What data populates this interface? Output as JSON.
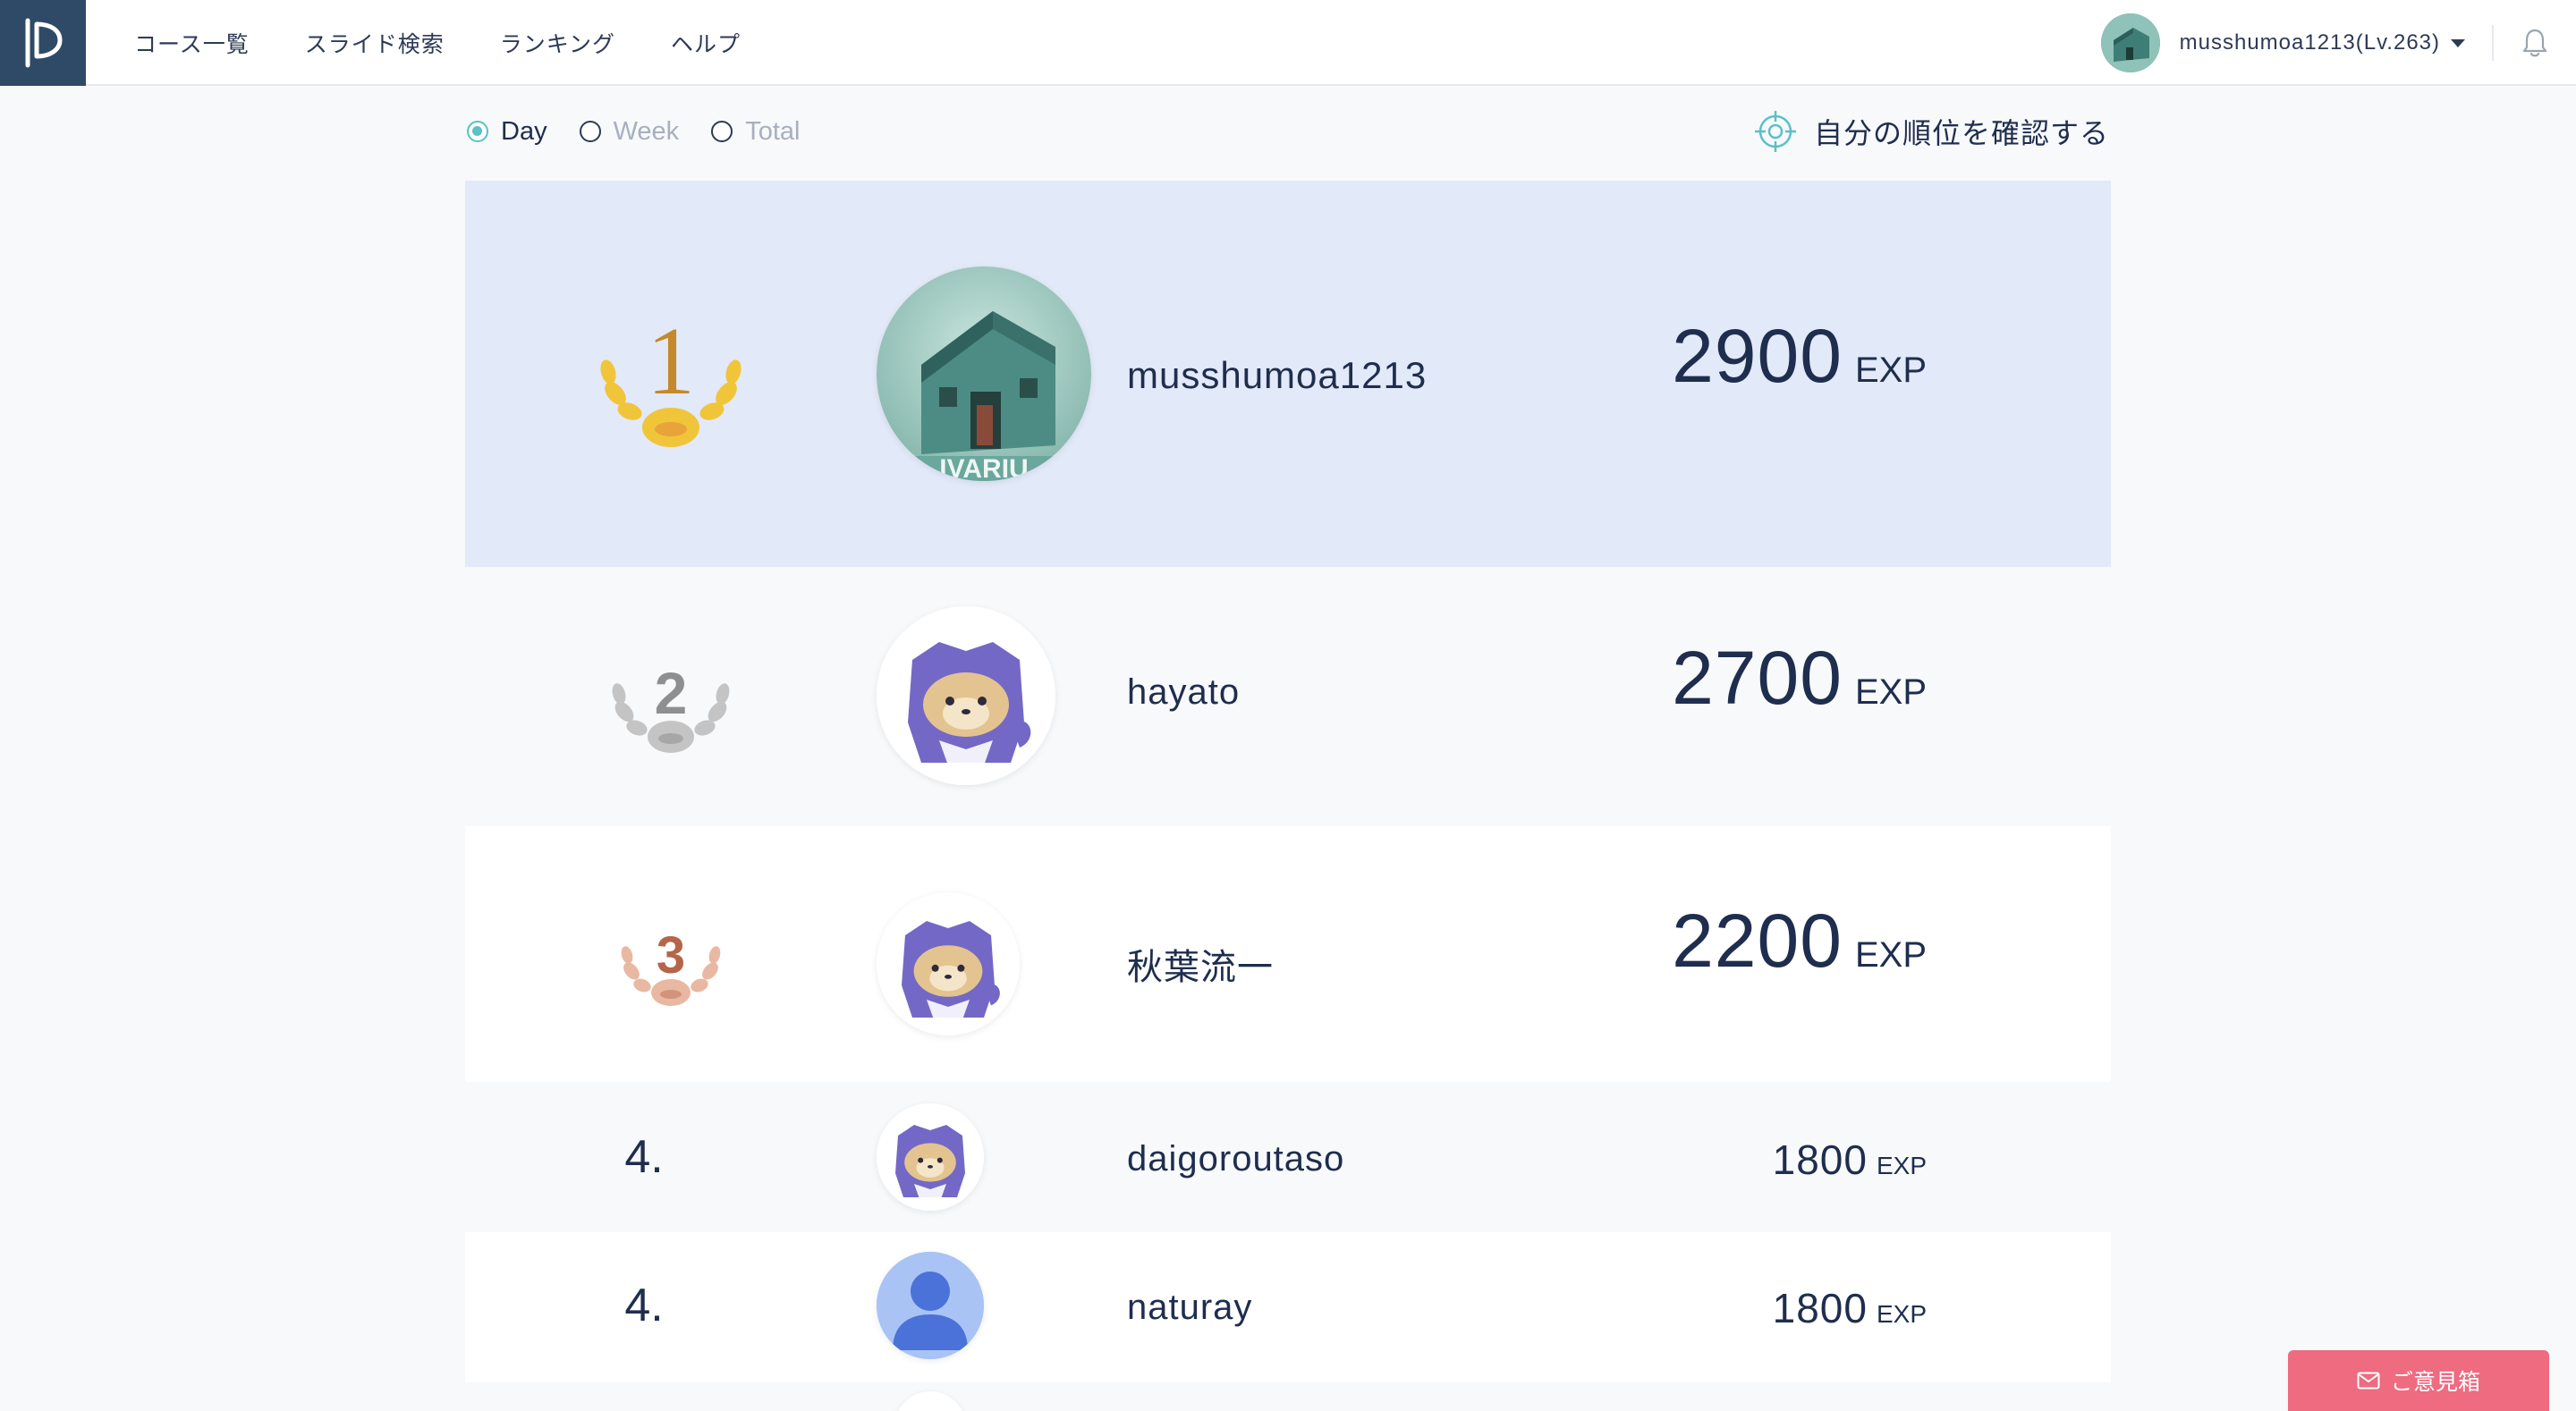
{
  "nav": {
    "items": [
      "コース一覧",
      "スライド検索",
      "ランキング",
      "ヘルプ"
    ]
  },
  "user": {
    "display": "musshumoa1213(Lv.263)"
  },
  "filters": {
    "options": [
      "Day",
      "Week",
      "Total"
    ],
    "selected": "Day",
    "my_rank_label": "自分の順位を確認する"
  },
  "ranking": [
    {
      "rank": "1",
      "name": "musshumoa1213",
      "score": "2900",
      "unit": "EXP",
      "avatar": "house-photo"
    },
    {
      "rank": "2",
      "name": "hayato",
      "score": "2700",
      "unit": "EXP",
      "avatar": "mascot"
    },
    {
      "rank": "3",
      "name": "秋葉流一",
      "score": "2200",
      "unit": "EXP",
      "avatar": "mascot"
    },
    {
      "rank": "4.",
      "name": "daigoroutaso",
      "score": "1800",
      "unit": "EXP",
      "avatar": "mascot"
    },
    {
      "rank": "4.",
      "name": "naturay",
      "score": "1800",
      "unit": "EXP",
      "avatar": "default-user"
    }
  ],
  "feedback": {
    "label": "ご意見箱"
  },
  "colors": {
    "accent": "#5bc0c8",
    "header_logo_bg": "#2f4a66",
    "highlight_row": "#e2e9f8",
    "gold": "#c4892b",
    "silver": "#8f8f8f",
    "bronze": "#b5654a",
    "feedback": "#ee6b80",
    "mascot": "#7468c6"
  }
}
